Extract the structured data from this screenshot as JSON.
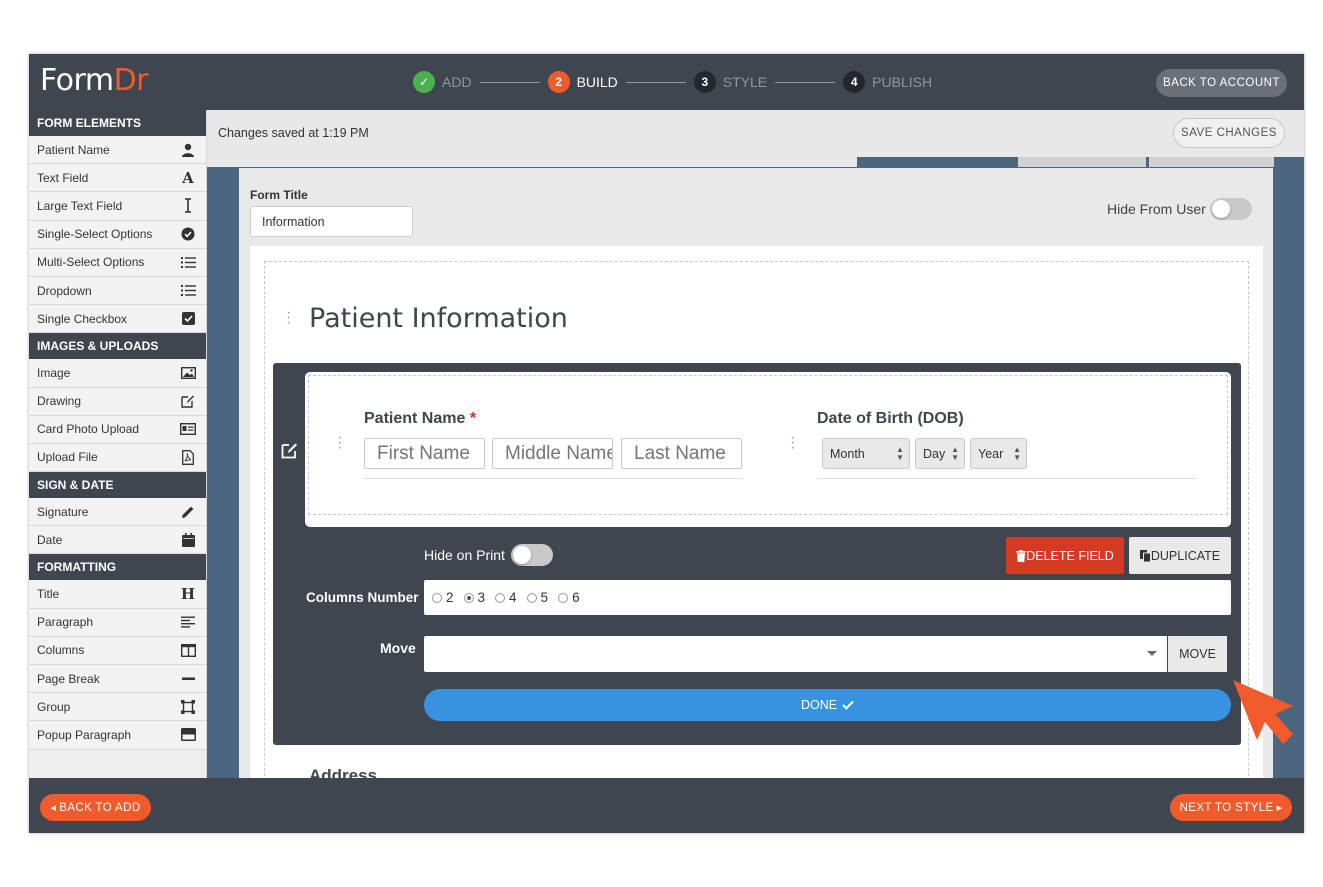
{
  "app": {
    "logo_main": "Form",
    "logo_accent": "Dr",
    "back_to_account": "BACK TO ACCOUNT",
    "steps": [
      {
        "num": "✓",
        "label": "ADD",
        "state": "done"
      },
      {
        "num": "2",
        "label": "BUILD",
        "state": "active"
      },
      {
        "num": "3",
        "label": "STYLE",
        "state": "pending"
      },
      {
        "num": "4",
        "label": "PUBLISH",
        "state": "pending"
      }
    ]
  },
  "sidebar": {
    "form_elements": {
      "heading": "FORM ELEMENTS",
      "items": [
        {
          "label": "Patient Name",
          "icon": "person-icon"
        },
        {
          "label": "Text Field",
          "icon": "text-a-icon"
        },
        {
          "label": "Large Text Field",
          "icon": "text-cursor-icon"
        },
        {
          "label": "Single-Select Options",
          "icon": "check-circle-icon"
        },
        {
          "label": "Multi-Select Options",
          "icon": "list-icon"
        },
        {
          "label": "Dropdown",
          "icon": "list-icon"
        },
        {
          "label": "Single Checkbox",
          "icon": "checkbox-icon"
        }
      ]
    },
    "images_uploads": {
      "heading": "IMAGES & UPLOADS",
      "items": [
        {
          "label": "Image",
          "icon": "image-icon"
        },
        {
          "label": "Drawing",
          "icon": "edit-icon"
        },
        {
          "label": "Card Photo Upload",
          "icon": "id-card-icon"
        },
        {
          "label": "Upload File",
          "icon": "pdf-file-icon"
        }
      ]
    },
    "sign_date": {
      "heading": "SIGN & DATE",
      "items": [
        {
          "label": "Signature",
          "icon": "pencil-icon"
        },
        {
          "label": "Date",
          "icon": "calendar-icon"
        }
      ]
    },
    "formatting": {
      "heading": "FORMATTING",
      "items": [
        {
          "label": "Title",
          "icon": "heading-icon"
        },
        {
          "label": "Paragraph",
          "icon": "align-left-icon"
        },
        {
          "label": "Columns",
          "icon": "columns-icon"
        },
        {
          "label": "Page Break",
          "icon": "minus-icon"
        },
        {
          "label": "Group",
          "icon": "group-icon"
        },
        {
          "label": "Popup Paragraph",
          "icon": "window-icon"
        }
      ]
    }
  },
  "savebar": {
    "status": "Changes saved at 1:19 PM",
    "save_label": "SAVE CHANGES"
  },
  "form": {
    "title_label": "Form Title",
    "title_value": "Information",
    "hide_from_user": "Hide From User",
    "section_title": "Patient Information",
    "patient_name_label": "Patient Name",
    "required_mark": "*",
    "first_placeholder": "First Name",
    "middle_placeholder": "Middle Name",
    "last_placeholder": "Last Name",
    "dob_label": "Date of Birth (DOB)",
    "month": "Month",
    "day": "Day",
    "year": "Year",
    "next_section": "Address"
  },
  "edit_panel": {
    "hide_on_print": "Hide on Print",
    "delete_label": "DELETE FIELD",
    "duplicate_label": "DUPLICATE",
    "columns_label": "Columns Number",
    "column_options": [
      "2",
      "3",
      "4",
      "5",
      "6"
    ],
    "selected_column": "3",
    "move_label": "Move",
    "move_button": "MOVE",
    "done_label": "DONE"
  },
  "footer": {
    "back_label": "BACK TO ADD",
    "next_label": "NEXT TO STYLE"
  },
  "colors": {
    "accent": "#f15a2b",
    "dark": "#3f4650",
    "blue": "#3793e0",
    "danger": "#d53a22",
    "success": "#4caf50"
  }
}
